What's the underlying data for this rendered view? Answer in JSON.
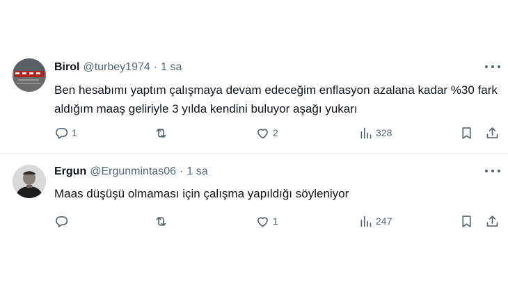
{
  "tweets": [
    {
      "name": "Birol",
      "handle": "@turbey1974",
      "separator": "·",
      "time": "1 sa",
      "text": "Ben hesabımı yaptım çalışmaya devam edeceğim enflasyon azalana kadar %30 fark aldığım maaş geliriyle 3 yılda kendini buluyor aşağı yukarı",
      "replies": "1",
      "retweets": "",
      "likes": "2",
      "views": "328"
    },
    {
      "name": "Ergun",
      "handle": "@Ergunmintas06",
      "separator": "·",
      "time": "1 sa",
      "text": "Maas düşüşü olmaması için çalışma yapıldığı söyleniyor",
      "replies": "",
      "retweets": "",
      "likes": "1",
      "views": "247"
    }
  ],
  "colors": {
    "text": "#0f1419",
    "muted": "#536471",
    "divider": "#e6ecf0"
  },
  "icons": [
    "reply-icon",
    "retweet-icon",
    "like-icon",
    "views-icon",
    "bookmark-icon",
    "share-icon",
    "more-icon"
  ]
}
